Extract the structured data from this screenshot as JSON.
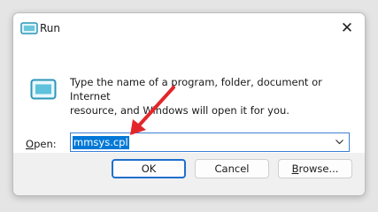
{
  "window": {
    "title": "Run"
  },
  "icons": {
    "app": "run-dialog-icon",
    "close": "close-icon",
    "run": "run-program-icon",
    "dropdown": "chevron-down-icon",
    "annotation": "red-arrow"
  },
  "dialog": {
    "description_line1": "Type the name of a program, folder, document or Internet",
    "description_line2": "resource, and Windows will open it for you.",
    "open_label_accel": "O",
    "open_label_rest": "pen:",
    "open_value": "mmsys.cpl"
  },
  "buttons": {
    "ok": "OK",
    "cancel": "Cancel",
    "browse_accel": "B",
    "browse_rest": "rowse..."
  },
  "colors": {
    "accent": "#0078d7",
    "annotation": "#e3262b"
  }
}
